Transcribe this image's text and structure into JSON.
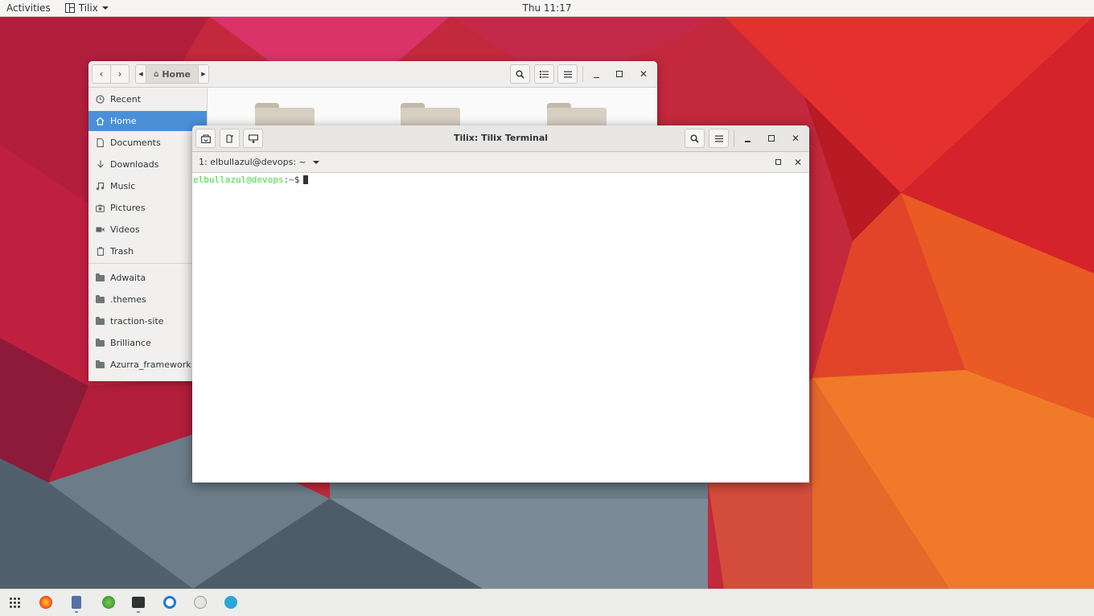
{
  "topbar": {
    "activities": "Activities",
    "app_name": "Tilix",
    "clock": "Thu 11:17"
  },
  "files": {
    "breadcrumb_home": "Home",
    "sidebar": [
      {
        "label": "Recent",
        "icon": "clock-icon"
      },
      {
        "label": "Home",
        "icon": "home-icon",
        "active": true
      },
      {
        "label": "Documents",
        "icon": "document-icon"
      },
      {
        "label": "Downloads",
        "icon": "download-icon"
      },
      {
        "label": "Music",
        "icon": "music-icon"
      },
      {
        "label": "Pictures",
        "icon": "camera-icon"
      },
      {
        "label": "Videos",
        "icon": "video-icon"
      },
      {
        "label": "Trash",
        "icon": "trash-icon"
      }
    ],
    "bookmarks": [
      {
        "label": "Adwaita",
        "icon": "folder-icon"
      },
      {
        "label": ".themes",
        "icon": "folder-icon"
      },
      {
        "label": "traction-site",
        "icon": "folder-icon"
      },
      {
        "label": "Brilliance",
        "icon": "folder-icon"
      },
      {
        "label": "Azurra_framework",
        "icon": "folder-icon"
      }
    ]
  },
  "tilix": {
    "title": "Tilix: Tilix Terminal",
    "session_label": "1: elbullazul@devops: ~",
    "prompt_user": "elbullazul@devops",
    "prompt_path": ":~",
    "prompt_symbol": "$"
  },
  "dock": {
    "items": [
      "apps-grid-icon",
      "firefox-icon",
      "notes-icon",
      "globe-icon",
      "terminal-icon",
      "clock-app-icon",
      "screenshot-icon",
      "audio-icon"
    ]
  },
  "colors": {
    "accent": "#4a90d9",
    "prompt_user": "#3ddc3d",
    "prompt_path": "#3465a4"
  }
}
